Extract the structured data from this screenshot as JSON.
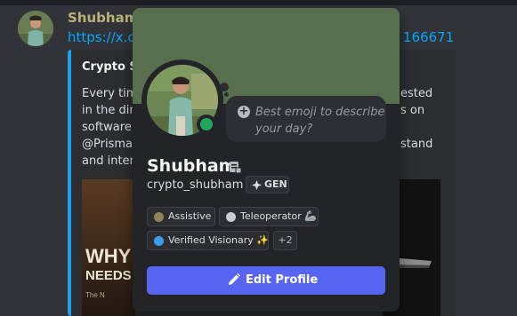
{
  "chat": {
    "author": "Shubham",
    "link_start": "https://x.c",
    "link_end": "166671",
    "embed": {
      "title": "Crypto Sh",
      "body_left": [
        "Every tim",
        "in the dire",
        "software f",
        "@Prisma?",
        "and intera"
      ],
      "body_right": [
        "ested",
        "s on",
        "",
        "stand",
        ""
      ],
      "image_text": [
        "WHY",
        "NEEDS",
        "The N"
      ]
    }
  },
  "profile": {
    "display_name": "Shubham",
    "username": "crypto_shubham",
    "tag": "GEN",
    "status_prompt": [
      "Best emoji to describe",
      "your day?"
    ],
    "status": "online",
    "roles": [
      {
        "label": "Assistive",
        "color": "#8e8456"
      },
      {
        "label": "Teleoperator 🦾",
        "color": "#c9ccd1"
      },
      {
        "label": "Verified Visionary ✨",
        "color": "#3c9bea"
      }
    ],
    "more_roles": "+2",
    "edit_button": "Edit Profile"
  },
  "colors": {
    "banner": "#586f4e",
    "accent": "#5865f2",
    "online": "#23a55a",
    "link": "#00a8fc"
  },
  "icons": [
    "plus-icon",
    "note-icon",
    "gen-clan-icon",
    "pencil-icon"
  ]
}
